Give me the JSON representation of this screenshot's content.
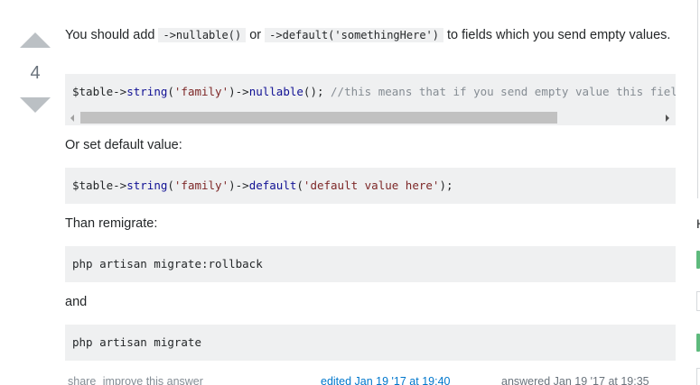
{
  "votes": {
    "count": "4"
  },
  "answer": {
    "intro_text_1": "You should add",
    "intro_code_1": "->nullable()",
    "intro_text_2": "or",
    "intro_code_2": "->default('somethingHere')",
    "intro_text_3": "to fields which you send empty values.",
    "code1": {
      "var": "$table->",
      "fn1": "string",
      "p1": "(",
      "str1": "'family'",
      "p2": ")->",
      "fn2": "nullable",
      "p3": "(); ",
      "comment": "//this means that if you send empty value this field wil"
    },
    "text_or": "Or set default value:",
    "code2": {
      "var": "$table->",
      "fn1": "string",
      "p1": "(",
      "str1": "'family'",
      "p2": ")->",
      "fn2": "default",
      "p3": "(",
      "str2": "'default value here'",
      "p4": ");"
    },
    "text_than": "Than remigrate:",
    "code3": "php artisan migrate:rollback",
    "text_and": "and",
    "code4": "php artisan migrate"
  },
  "footer": {
    "share": "share",
    "improve": "improve this answer",
    "edited": "edited Jan 19 '17 at 19:40",
    "answered": "answered Jan 19 '17 at 19:35"
  },
  "right_edge": {
    "partial_text": "H"
  }
}
